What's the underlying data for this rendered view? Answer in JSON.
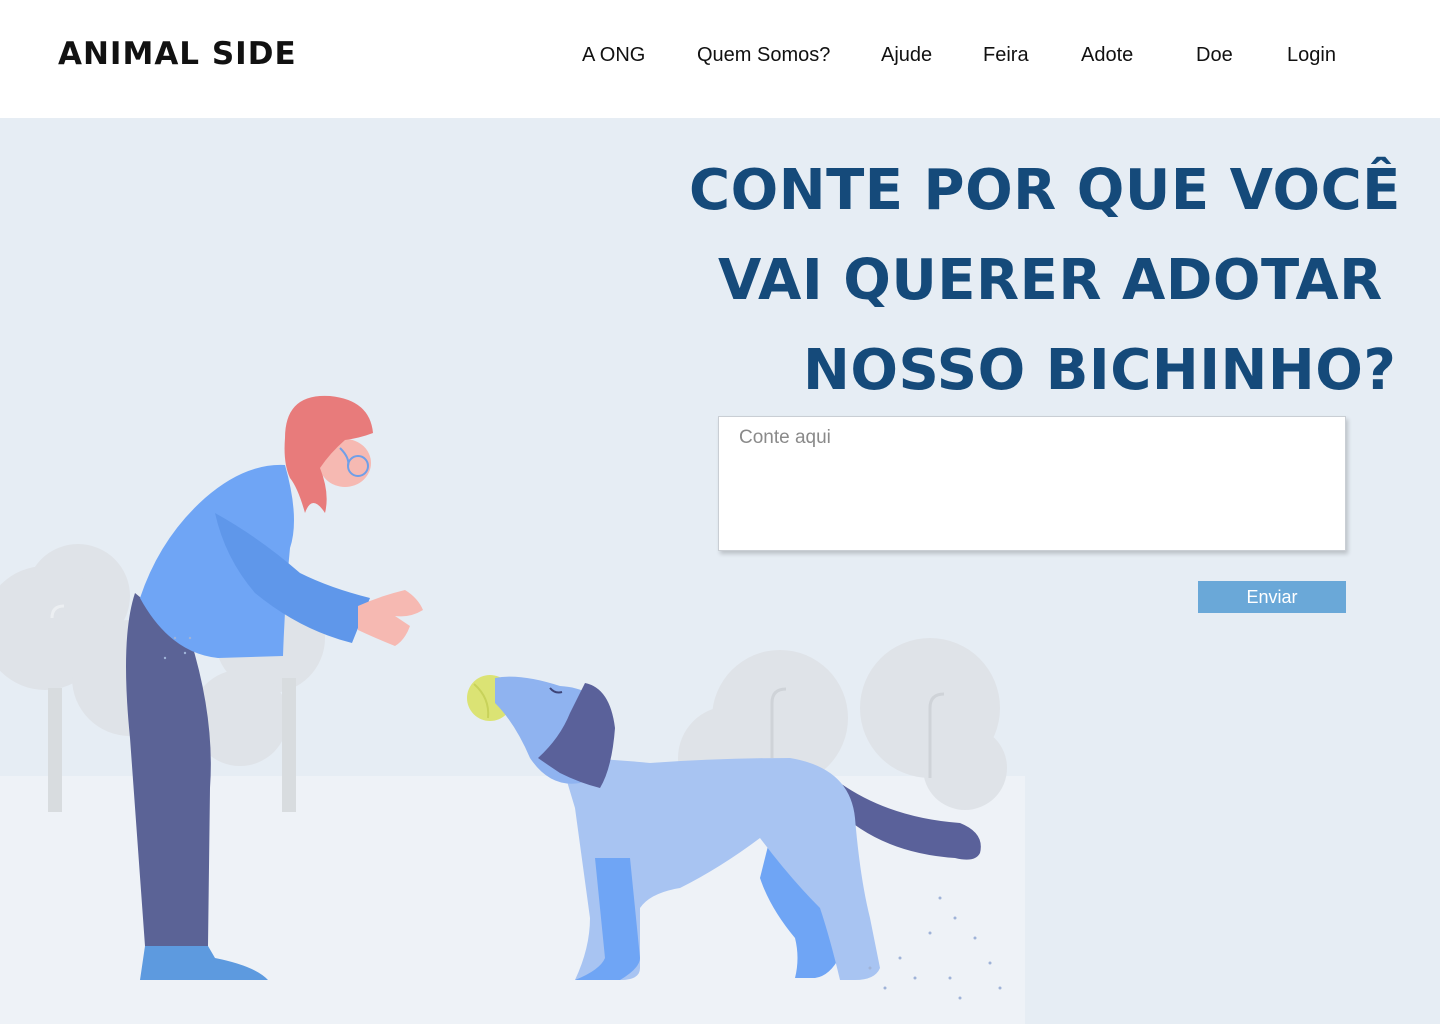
{
  "header": {
    "logo": "ANIMAL SIDE",
    "nav": [
      {
        "label": "A ONG"
      },
      {
        "label": "Quem Somos?"
      },
      {
        "label": "Ajude"
      },
      {
        "label": "Feira"
      },
      {
        "label": "Adote"
      },
      {
        "label": "Doe"
      },
      {
        "label": "Login"
      }
    ]
  },
  "hero": {
    "headline_lines": [
      "CONTE POR QUE VOCÊ",
      "VAI QUERER ADOTAR",
      "NOSSO BICHINHO?"
    ],
    "story_placeholder": "Conte aqui",
    "story_value": "",
    "send_label": "Enviar"
  },
  "colors": {
    "header_bg": "#ffffff",
    "hero_bg": "#e6edf4",
    "headline": "#154a7a",
    "button": "#6aa8d8"
  },
  "illustration": {
    "subjects": [
      "woman-icon",
      "dog-icon",
      "tennis-ball-icon",
      "tree-icon"
    ]
  }
}
